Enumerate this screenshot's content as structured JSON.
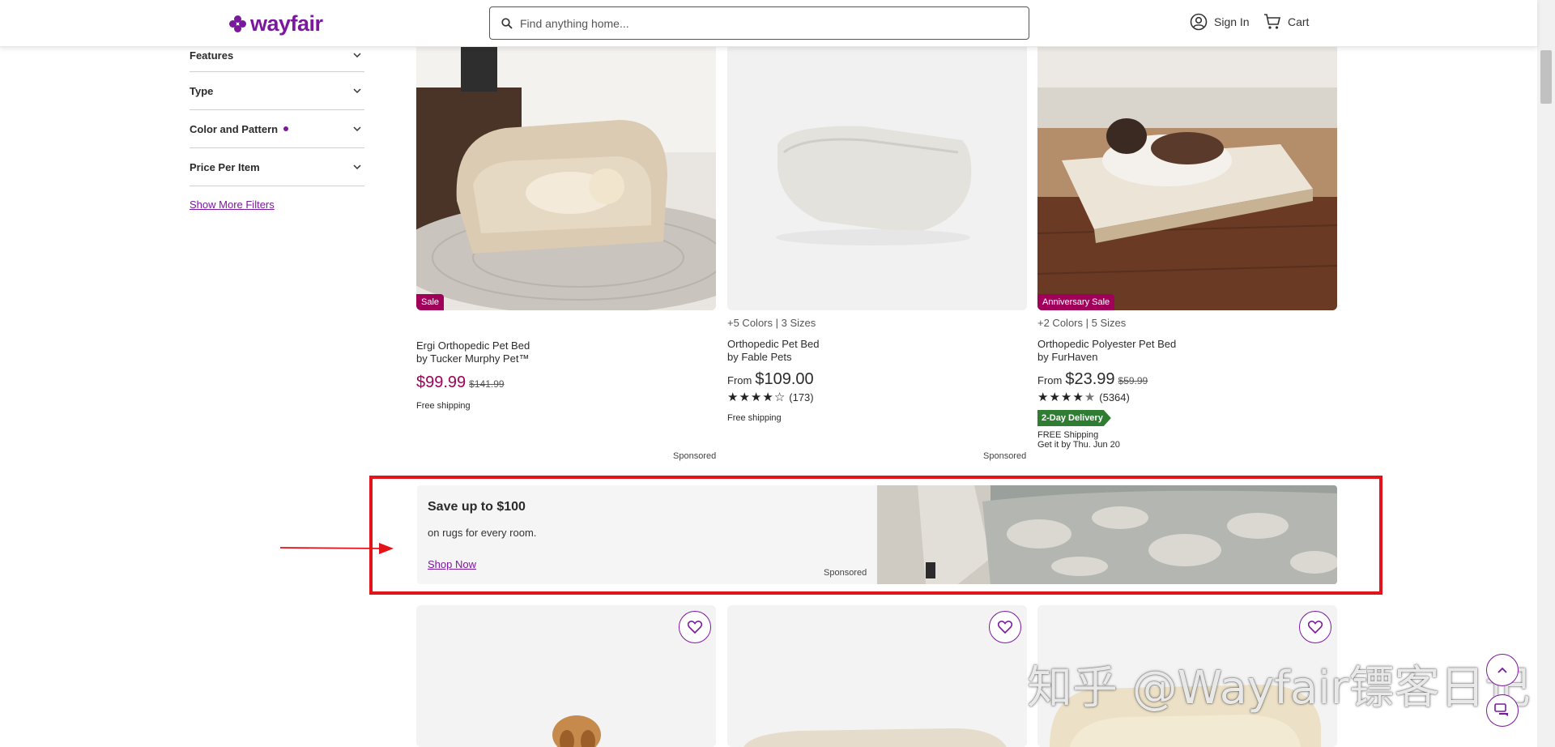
{
  "header": {
    "logo_text": "wayfair",
    "search_placeholder": "Find anything home...",
    "sign_in_label": "Sign In",
    "cart_label": "Cart"
  },
  "sidebar": {
    "filters": [
      {
        "label": "Features",
        "active": false
      },
      {
        "label": "Type",
        "active": false
      },
      {
        "label": "Color and Pattern",
        "active": true
      },
      {
        "label": "Price Per Item",
        "active": false
      }
    ],
    "show_more_label": "Show More Filters"
  },
  "products": [
    {
      "badge": "Sale",
      "options": "",
      "name": "Ergi Orthopedic Pet Bed",
      "brand": "by Tucker Murphy Pet™",
      "price_prefix": "",
      "price": "$99.99",
      "price_old": "$141.99",
      "rating": null,
      "reviews": "",
      "delivery_badge": "",
      "shipping": "Free shipping",
      "shipping_eta": "",
      "sponsored": "Sponsored"
    },
    {
      "badge": "",
      "options": "+5 Colors | 3 Sizes",
      "name": "Orthopedic Pet Bed",
      "brand": "by Fable Pets",
      "price_prefix": "From",
      "price": "$109.00",
      "price_old": "",
      "rating": 4,
      "reviews": "(173)",
      "delivery_badge": "",
      "shipping": "Free shipping",
      "shipping_eta": "",
      "sponsored": "Sponsored"
    },
    {
      "badge": "Anniversary Sale",
      "options": "+2 Colors | 5 Sizes",
      "name": "Orthopedic Polyester Pet Bed",
      "brand": "by FurHaven",
      "price_prefix": "From",
      "price": "$23.99",
      "price_old": "$59.99",
      "rating": 4.5,
      "reviews": "(5364)",
      "delivery_badge": "2-Day Delivery",
      "shipping": "FREE Shipping",
      "shipping_eta": "Get it by Thu. Jun 20",
      "sponsored": ""
    }
  ],
  "banner": {
    "title": "Save up to $100",
    "subtitle": "on rugs for every room.",
    "cta": "Shop Now",
    "sponsored": "Sponsored"
  },
  "watermark": "知乎 @Wayfair镖客日记",
  "colors": {
    "brand": "#7b189f",
    "sale": "#a1005a",
    "highlight_box": "#e2141a",
    "delivery": "#2f7d32"
  },
  "icons": [
    "search-icon",
    "account-icon",
    "cart-icon",
    "chevron-down-icon",
    "heart-icon",
    "scroll-up-icon",
    "chat-icon"
  ]
}
